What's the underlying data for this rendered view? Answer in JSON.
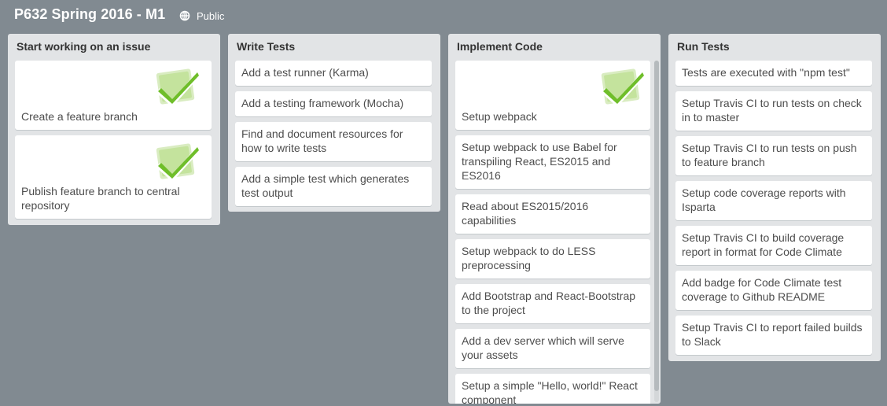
{
  "board": {
    "title": "P632 Spring 2016 - M1",
    "visibility": "Public"
  },
  "lists": [
    {
      "title": "Start working on an issue",
      "cards": [
        {
          "text": "Create a feature branch",
          "completed": true
        },
        {
          "text": "Publish feature branch to central repository",
          "completed": true
        }
      ]
    },
    {
      "title": "Write Tests",
      "cards": [
        {
          "text": "Add a test runner (Karma)"
        },
        {
          "text": "Add a testing framework (Mocha)"
        },
        {
          "text": "Find and document resources for how to write tests"
        },
        {
          "text": "Add a simple test which generates test output"
        }
      ]
    },
    {
      "title": "Implement Code",
      "cards": [
        {
          "text": "Setup webpack",
          "completed": true
        },
        {
          "text": "Setup webpack to use Babel for transpiling React, ES2015 and ES2016"
        },
        {
          "text": "Read about ES2015/2016 capabilities"
        },
        {
          "text": "Setup webpack to do LESS preprocessing"
        },
        {
          "text": "Add Bootstrap and React-Bootstrap to the project"
        },
        {
          "text": "Add a dev server which will serve your assets"
        },
        {
          "text": "Setup a simple \"Hello, world!\" React component"
        }
      ]
    },
    {
      "title": "Run Tests",
      "cards": [
        {
          "text": "Tests are executed with \"npm test\""
        },
        {
          "text": "Setup Travis CI to run tests on check in to master"
        },
        {
          "text": "Setup Travis CI to run tests on push to feature branch"
        },
        {
          "text": "Setup code coverage reports with Isparta"
        },
        {
          "text": "Setup Travis CI to build coverage report in format for Code Climate"
        },
        {
          "text": "Add badge for Code Climate test coverage to Github README"
        },
        {
          "text": "Setup Travis CI to report failed builds to Slack"
        }
      ]
    }
  ],
  "colors": {
    "background": "#818a91",
    "list": "#e2e4e6",
    "card": "#ffffff",
    "check_green": "#6fbe2a"
  },
  "icons": {
    "visibility": "globe-icon",
    "completed": "checkmark-icon"
  }
}
